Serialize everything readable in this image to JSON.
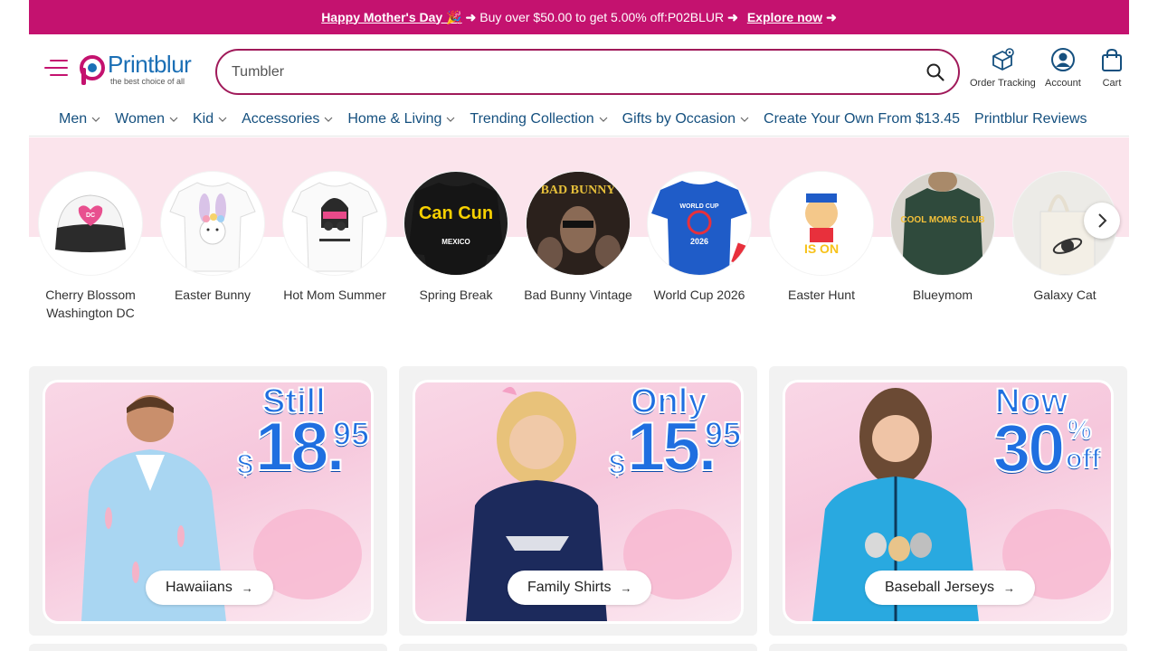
{
  "promo": {
    "highlight": "Happy Mother's Day 🎉",
    "arrow1": "➜",
    "offer": "Buy over $50.00 to get 5.00% off:P02BLUR",
    "arrow2": "➜",
    "cta": "Explore now",
    "arrow3": "➜"
  },
  "brand": {
    "name": "Printblur",
    "tagline": "the best choice of all"
  },
  "search": {
    "value": "Tumbler",
    "placeholder": "Tumbler"
  },
  "header_actions": {
    "order_tracking": "Order Tracking",
    "account": "Account",
    "cart": "Cart"
  },
  "nav": [
    {
      "label": "Men"
    },
    {
      "label": "Women"
    },
    {
      "label": "Kid"
    },
    {
      "label": "Accessories"
    },
    {
      "label": "Home & Living"
    },
    {
      "label": "Trending Collection"
    },
    {
      "label": "Gifts by Occasion"
    },
    {
      "label": "Create Your Own From $13.45"
    },
    {
      "label": "Printblur Reviews"
    }
  ],
  "categories": [
    {
      "label": "Cherry Blossom Washington DC"
    },
    {
      "label": "Easter Bunny"
    },
    {
      "label": "Hot Mom Summer"
    },
    {
      "label": "Spring Break"
    },
    {
      "label": "Bad Bunny Vintage"
    },
    {
      "label": "World Cup 2026"
    },
    {
      "label": "Easter Hunt"
    },
    {
      "label": "Blueymom"
    },
    {
      "label": "Galaxy Cat"
    }
  ],
  "product_art": {
    "cancun": "Can Cun",
    "mexico": "MEXICO",
    "bad_bunny": "BAD BUNNY",
    "world_cup": "WORLD CUP",
    "world_cup_year": "2026",
    "easter": "IS ON",
    "cool_moms": "COOL MOMS CLUB"
  },
  "promo_cards": [
    {
      "headline": "Still",
      "currency": "$",
      "price": "18.",
      "cents": "95",
      "label": "Hawaiians",
      "arrow": "→"
    },
    {
      "headline": "Only",
      "currency": "$",
      "price": "15.",
      "cents": "95",
      "label": "Family Shirts",
      "arrow": "→"
    },
    {
      "headline": "Now",
      "percent": "30",
      "percent_sign": "%",
      "off": "off",
      "label": "Baseball Jerseys",
      "arrow": "→"
    }
  ],
  "colors": {
    "promo_bar": "#c4126f",
    "brand_blue": "#1b6fb5",
    "nav_text": "#15507f",
    "strip_pink": "#fbe4ec",
    "price_blue": "#1f6fe0"
  }
}
